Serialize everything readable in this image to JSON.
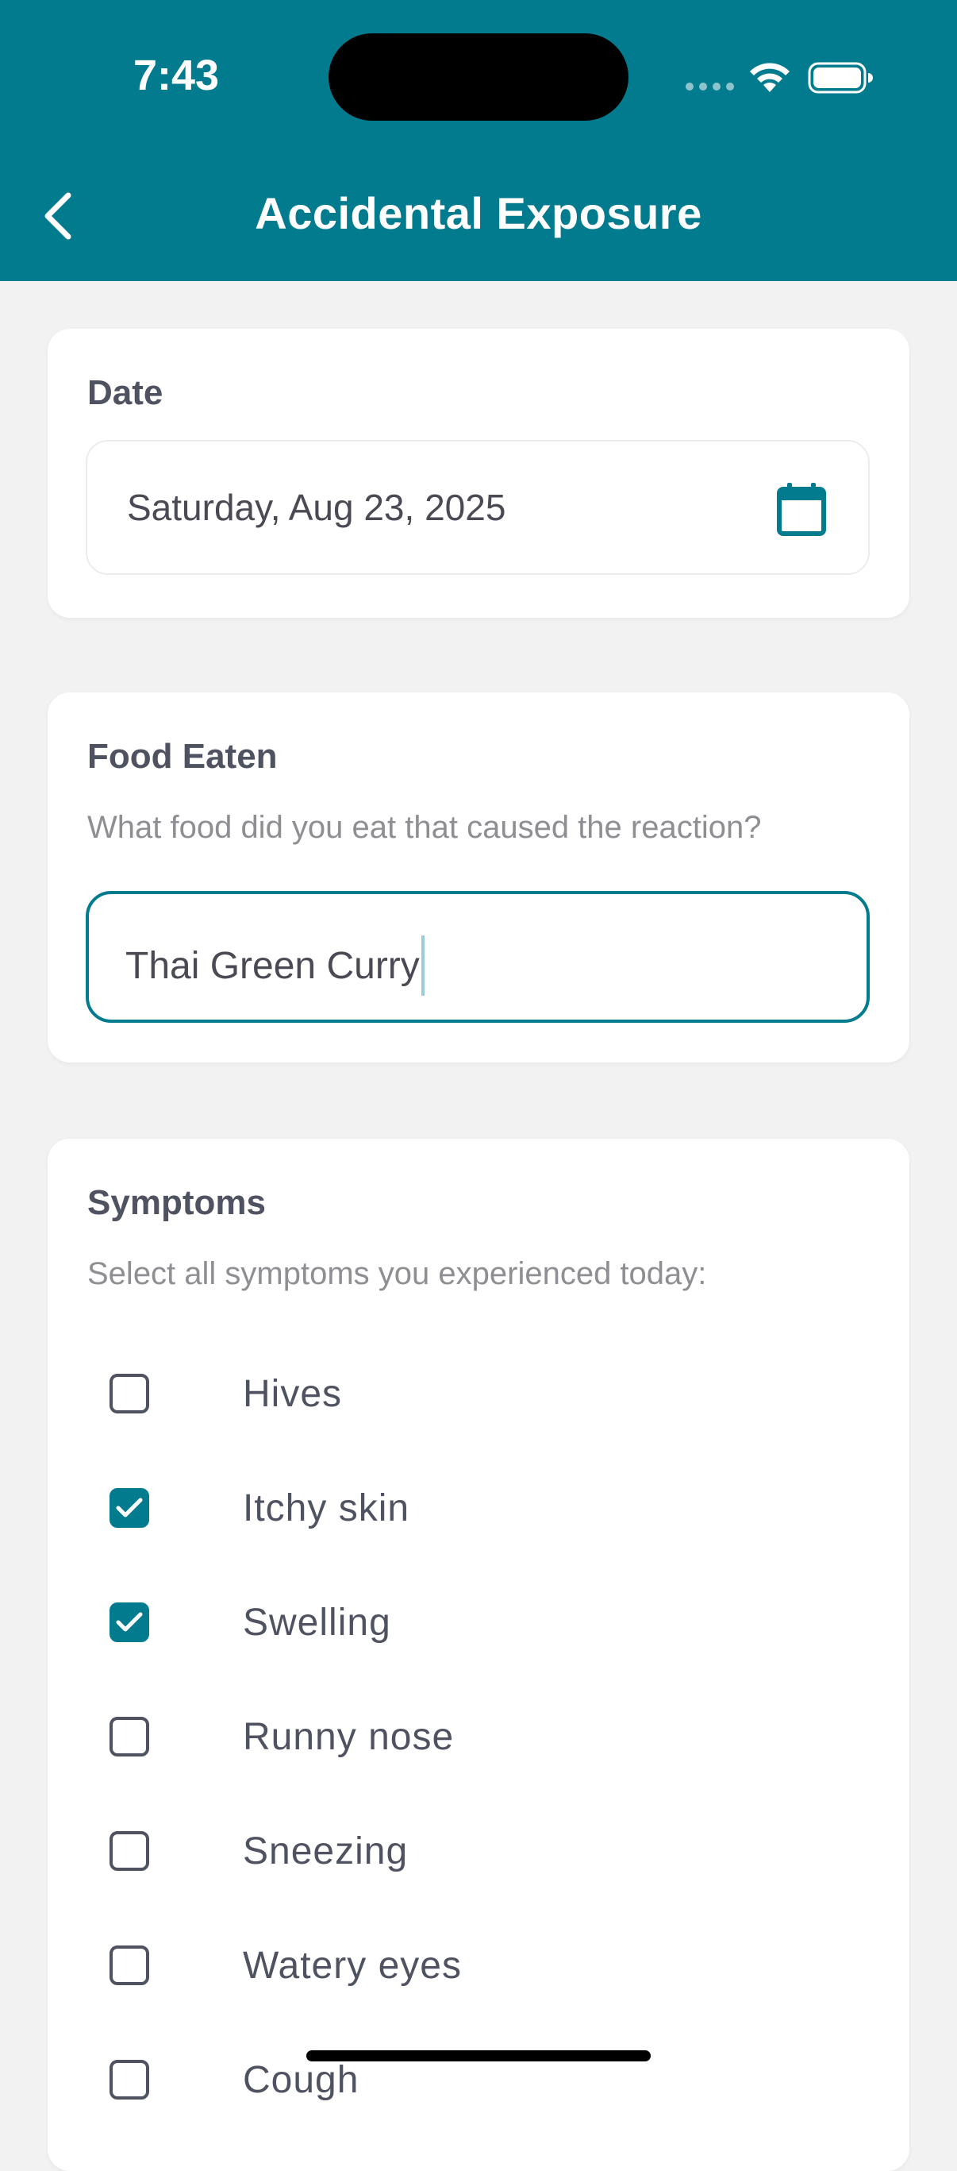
{
  "status_bar": {
    "time": "7:43"
  },
  "nav": {
    "title": "Accidental Exposure"
  },
  "date_card": {
    "label": "Date",
    "value": "Saturday, Aug 23, 2025"
  },
  "food_card": {
    "label": "Food Eaten",
    "help": "What food did you eat that caused the reaction?",
    "value": "Thai Green Curry"
  },
  "symptoms_card": {
    "label": "Symptoms",
    "help": "Select all symptoms you experienced today:",
    "items": [
      {
        "label": "Hives",
        "checked": false
      },
      {
        "label": "Itchy skin",
        "checked": true
      },
      {
        "label": "Swelling",
        "checked": true
      },
      {
        "label": "Runny nose",
        "checked": false
      },
      {
        "label": "Sneezing",
        "checked": false
      },
      {
        "label": "Watery eyes",
        "checked": false
      },
      {
        "label": "Cough",
        "checked": false
      }
    ]
  },
  "colors": {
    "accent": "#037b8f",
    "background": "#f2f2f2"
  },
  "icons": [
    "back-chevron-icon",
    "calendar-icon",
    "checkmark-icon",
    "wifi-icon",
    "battery-icon"
  ]
}
